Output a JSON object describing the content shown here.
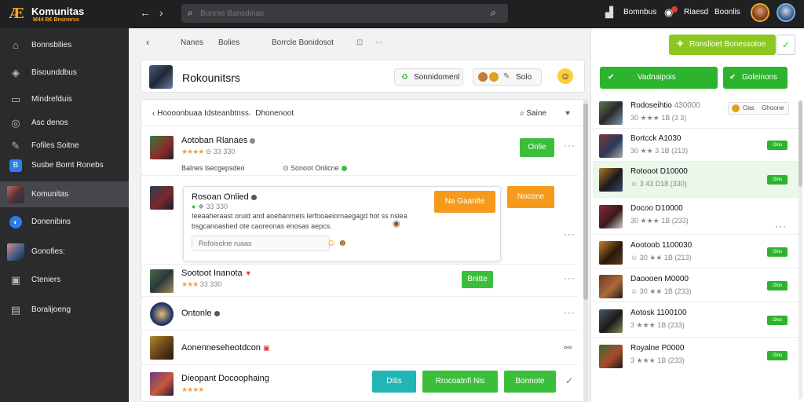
{
  "app": {
    "logo_mark": "Æ",
    "logo_title": "Komunitas",
    "logo_subtitle": "M44 B€ Bnsnorss",
    "search_placeholder": "Bunrse Bansdinas",
    "top_items": [
      "Bomnbus",
      "Riaesd",
      "Boonlis"
    ]
  },
  "sidebar": {
    "items": [
      {
        "label": "Bonnsbilies",
        "icon": "home-icon"
      },
      {
        "label": "Bisounddbus",
        "icon": "controller-icon"
      },
      {
        "label": "Mindrefduis",
        "icon": "screen-icon"
      },
      {
        "label": "Asc denos",
        "icon": "gamepad-icon"
      },
      {
        "label": "Fofiles Soitne",
        "icon": "wrench-icon"
      },
      {
        "label": "Susbe Bomt Ronebs",
        "icon": "app-icon"
      },
      {
        "label": "Komunitas",
        "icon": "game-thumb-icon"
      },
      {
        "label": "Donenibins",
        "icon": "circle-icon"
      },
      {
        "label": "Gonofies:",
        "icon": "game-thumb-icon"
      },
      {
        "label": "Cteniers",
        "icon": "display-icon"
      },
      {
        "label": "Boralijoeng",
        "icon": "screen-icon"
      }
    ]
  },
  "breadcrumbs": {
    "back": "‹",
    "items": [
      "Nanes",
      "Bolies",
      "Borrcle Bonidosot"
    ]
  },
  "header": {
    "title": "Rokounitsrs",
    "community_button": "Sonnidomenl",
    "pill_text": "Solo"
  },
  "filter": {
    "text": "Hoooonbuaa Idsteanbtnss.",
    "selected": "Dhonenoot",
    "search_label": "Saine"
  },
  "rows": [
    {
      "name": "Aotoban Rlanaes",
      "meta": "⊝ 33 330",
      "status": "Balnes lsecgepsdeo",
      "extra": "Sonoot Onlicne",
      "action": "Onlie"
    },
    {
      "name": "Rosoan Onlied",
      "meta": "❖ 33 330",
      "message": "Ieeaaheraast oruid and aoebanmeis lerfooaeiornaegagd hot ss nsiea bsgcanoasbed ote caoreonas enosas aepcs.",
      "reply_placeholder": "Rofoisolne ruaas",
      "action1": "Na Gaanlte",
      "action2": "Nocone"
    },
    {
      "name": "Sootoot Inanota",
      "meta": "33 330",
      "action": "Bnitte"
    },
    {
      "name": "Ontonle"
    },
    {
      "name": "Aonenneseheotdcon"
    },
    {
      "name": "Dieopant Docoophaing",
      "actions": [
        "Ditis",
        "Rrocoatnfi Nis",
        "Bonnote"
      ]
    }
  ],
  "right": {
    "top_button": "Ronslioet Bonessotoe",
    "btn1": "Vadnaipois",
    "btn2": "Goleinons",
    "list": [
      {
        "name": "Rodoseihtio",
        "meta": "30 ★★★ 1B (3 3)",
        "extra1": "430000",
        "extra2": "Oas",
        "extra3": "Ghoone"
      },
      {
        "name": "Bortcck A1030",
        "meta": "30 ★★ 3 1B (213)"
      },
      {
        "name": "Rotooot D10000",
        "meta": "☺ 3 43 D18 (330)"
      },
      {
        "name": "Docoo D10000",
        "meta": "30 ★★★ 1B (233)"
      },
      {
        "name": "Aootoob 1100030",
        "meta": "☺ 30 ★★ 1B (213)"
      },
      {
        "name": "Daoooen M0000",
        "meta": "☺ 30 ★★ 1B (233)"
      },
      {
        "name": "Aotosk 1100100",
        "meta": "3 ★★★ 1B (233)"
      },
      {
        "name": "Royalne P0000",
        "meta": "3 ★★★ 1B (233)"
      }
    ],
    "badge_label": "Olos"
  }
}
